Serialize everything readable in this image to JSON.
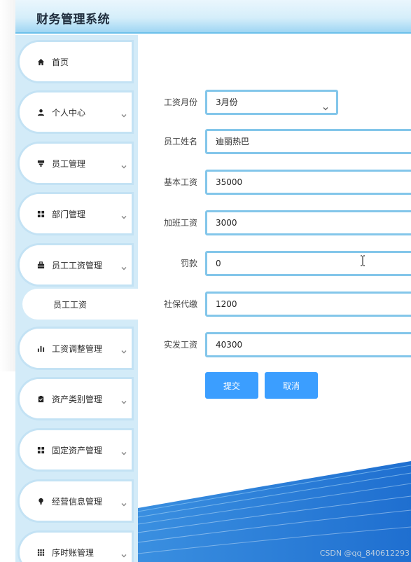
{
  "app": {
    "title": "财务管理系统"
  },
  "sidebar": {
    "items": [
      {
        "label": "首页",
        "icon": "home-icon",
        "has_chevron": false
      },
      {
        "label": "个人中心",
        "icon": "user-icon",
        "has_chevron": true
      },
      {
        "label": "员工管理",
        "icon": "employee-icon",
        "has_chevron": true
      },
      {
        "label": "部门管理",
        "icon": "grid-icon",
        "has_chevron": true
      },
      {
        "label": "员工工资管理",
        "icon": "briefcase-icon",
        "has_chevron": true,
        "expanded": true
      },
      {
        "label": "工资调整管理",
        "icon": "bar-chart-icon",
        "has_chevron": true
      },
      {
        "label": "资产类别管理",
        "icon": "clipboard-check-icon",
        "has_chevron": true
      },
      {
        "label": "固定资产管理",
        "icon": "grid-icon",
        "has_chevron": true
      },
      {
        "label": "经营信息管理",
        "icon": "lightbulb-icon",
        "has_chevron": true
      },
      {
        "label": "序时账管理",
        "icon": "apps-icon",
        "has_chevron": true
      }
    ],
    "sub_item": {
      "label": "员工工资"
    }
  },
  "form": {
    "fields": [
      {
        "label": "工资月份",
        "value": "3月份",
        "type": "select"
      },
      {
        "label": "员工姓名",
        "value": "迪丽热巴",
        "type": "text"
      },
      {
        "label": "基本工资",
        "value": "35000",
        "type": "text"
      },
      {
        "label": "加班工资",
        "value": "3000",
        "type": "text"
      },
      {
        "label": "罚款",
        "value": "0",
        "type": "text"
      },
      {
        "label": "社保代缴",
        "value": "1200",
        "type": "text"
      },
      {
        "label": "实发工资",
        "value": "40300",
        "type": "text"
      }
    ],
    "submit_label": "提交",
    "cancel_label": "取消"
  },
  "watermark": "CSDN @qq_840612293",
  "colors": {
    "accent": "#3b9eff",
    "field_border": "#83c6ea",
    "sidebar_bg": "#d3ebf8",
    "header_bottom": "#6cc0ea"
  }
}
